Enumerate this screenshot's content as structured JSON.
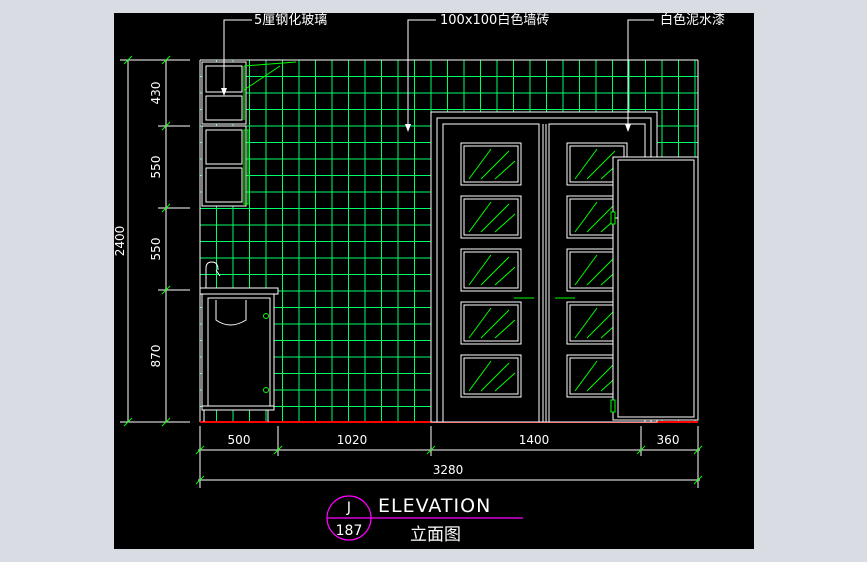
{
  "annotations": {
    "glass": "5厘钢化玻璃",
    "tile": "100x100白色墙砖",
    "paint": "白色泥水漆"
  },
  "dimensions": {
    "vertical_total": "2400",
    "vertical": [
      "430",
      "550",
      "550",
      "870"
    ],
    "horizontal": [
      "500",
      "1020",
      "1400",
      "360"
    ],
    "horizontal_total": "3280"
  },
  "title_block": {
    "letter": "J",
    "number": "187",
    "title": "ELEVATION",
    "subtitle": "立面图"
  },
  "colors": {
    "background": "#000000",
    "tile_grid": "#00ff66",
    "outline": "#ffffff",
    "glass_hatch": "#00ff00",
    "accent": "#ff00ff",
    "floor": "#ff0000",
    "frame": "#d9dce2"
  }
}
